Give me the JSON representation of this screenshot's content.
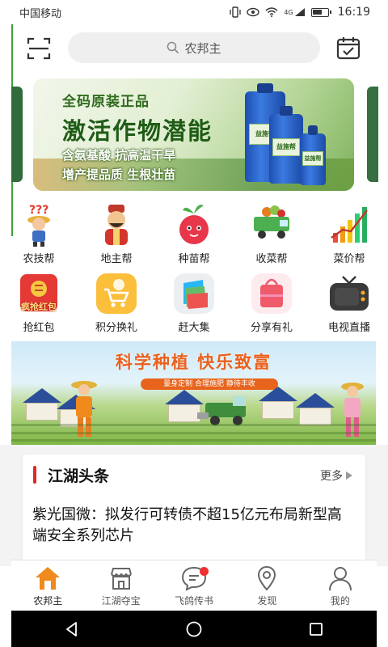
{
  "status_bar": {
    "carrier": "中国移动",
    "network": "4G",
    "time": "16:19"
  },
  "header": {
    "search_placeholder": "农邦主",
    "scan_icon": "scan-icon",
    "calendar_icon": "calendar-check-icon"
  },
  "hero_banner": {
    "line1": "全码原装正品",
    "line2": "激活作物潜能",
    "line3": "含氨基酸 抗高温干旱",
    "line4": "增产提品质 生根壮苗",
    "bottle_label": "益施帮"
  },
  "grid_row1": [
    {
      "label": "农技帮",
      "icon": "farmer-question-icon"
    },
    {
      "label": "地主帮",
      "icon": "landlord-icon"
    },
    {
      "label": "种苗帮",
      "icon": "radish-mascot-icon"
    },
    {
      "label": "收菜帮",
      "icon": "vegetable-truck-icon"
    },
    {
      "label": "菜价帮",
      "icon": "price-chart-icon"
    }
  ],
  "grid_row2": [
    {
      "label": "抢红包",
      "icon": "red-packet-icon",
      "badge": "疯抢红包"
    },
    {
      "label": "积分换礼",
      "icon": "points-cart-icon"
    },
    {
      "label": "赶大集",
      "icon": "market-wallet-icon"
    },
    {
      "label": "分享有礼",
      "icon": "gift-bag-icon"
    },
    {
      "label": "电视直播",
      "icon": "tv-icon"
    }
  ],
  "promo_banner": {
    "title": "科学种植 快乐致富",
    "ribbon": "量身定制  合理施肥  静待丰收"
  },
  "news": {
    "heading": "江湖头条",
    "more": "更多",
    "headline": "紫光国微：拟发行可转债不超15亿元布局新型高端安全系列芯片"
  },
  "tabbar": [
    {
      "label": "农邦主",
      "icon": "home-icon",
      "active": true
    },
    {
      "label": "江湖夺宝",
      "icon": "shop-icon"
    },
    {
      "label": "飞鸽传书",
      "icon": "message-icon",
      "has_dot": true
    },
    {
      "label": "发现",
      "icon": "location-icon"
    },
    {
      "label": "我的",
      "icon": "person-icon"
    }
  ],
  "colors": {
    "accent_orange": "#f08a1c",
    "news_bar_red": "#e02a2a",
    "dot_red": "#f0302e"
  }
}
